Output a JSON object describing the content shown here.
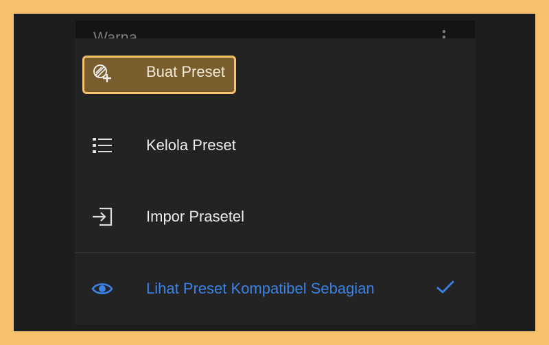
{
  "topbar": {
    "title": "Warna"
  },
  "menu": {
    "items": [
      {
        "label": "Buat Preset",
        "icon": "create-preset-icon",
        "highlighted": true
      },
      {
        "label": "Kelola Preset",
        "icon": "manage-list-icon"
      },
      {
        "label": "Impor Prasetel",
        "icon": "import-icon"
      },
      {
        "label": "Lihat Preset Kompatibel Sebagian",
        "icon": "eye-icon",
        "checked": true
      }
    ]
  },
  "colors": {
    "frame": "#f5c26b",
    "highlight_border": "#f7c36e",
    "highlight_fill": "#7a5d2c",
    "menu_bg": "#232323",
    "accent_blue": "#3b82e6"
  }
}
